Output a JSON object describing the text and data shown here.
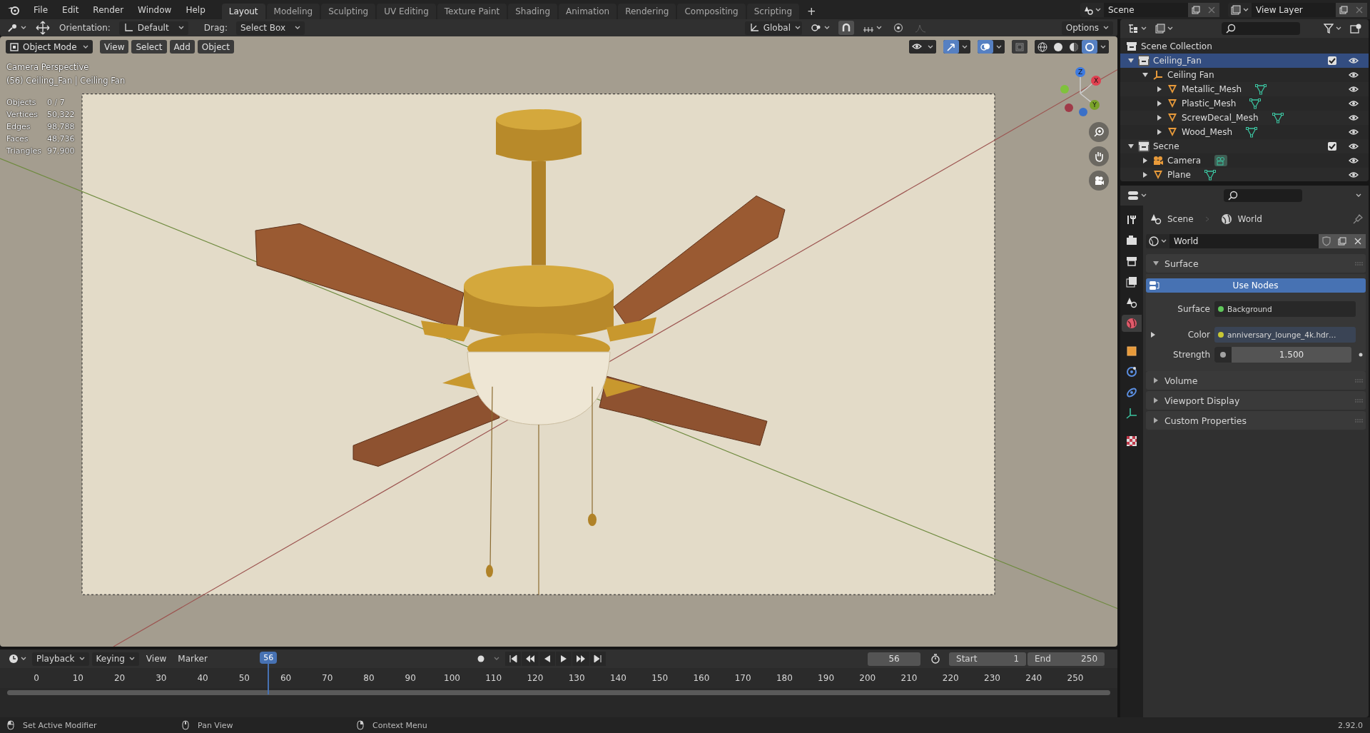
{
  "top_menu": [
    "File",
    "Edit",
    "Render",
    "Window",
    "Help"
  ],
  "workspaces": [
    {
      "label": "Layout",
      "selected": true
    },
    {
      "label": "Modeling",
      "selected": false
    },
    {
      "label": "Sculpting",
      "selected": false
    },
    {
      "label": "UV Editing",
      "selected": false
    },
    {
      "label": "Texture Paint",
      "selected": false
    },
    {
      "label": "Shading",
      "selected": false
    },
    {
      "label": "Animation",
      "selected": false
    },
    {
      "label": "Rendering",
      "selected": false
    },
    {
      "label": "Compositing",
      "selected": false
    },
    {
      "label": "Scripting",
      "selected": false
    }
  ],
  "add_workspace": "+",
  "scene_field": "Scene",
  "view_layer_field": "View Layer",
  "tool_header": {
    "orientation_label": "Orientation:",
    "orientation": "Default",
    "drag_label": "Drag:",
    "drag": "Select Box",
    "transform": "Global",
    "options": "Options"
  },
  "viewport_header": {
    "mode": "Object Mode",
    "menus": [
      "View",
      "Select",
      "Add",
      "Object"
    ],
    "toggles": [
      {
        "kind": "visibility",
        "on": false
      },
      {
        "kind": "gizmo",
        "on": true
      },
      {
        "kind": "overlay",
        "on": true
      },
      {
        "kind": "xray",
        "on": false
      }
    ],
    "shading": [
      {
        "kind": "wireframe",
        "selected": false
      },
      {
        "kind": "solid",
        "selected": false
      },
      {
        "kind": "material",
        "selected": false
      },
      {
        "kind": "rendered",
        "selected": true
      }
    ]
  },
  "viewport": {
    "view_name": "Camera Perspective",
    "object_info": "(56) Ceiling_Fan | Ceiling Fan",
    "stats": [
      {
        "label": "Objects",
        "value": "0 / 7"
      },
      {
        "label": "Vertices",
        "value": "50,322"
      },
      {
        "label": "Edges",
        "value": "98,788"
      },
      {
        "label": "Faces",
        "value": "48,736"
      },
      {
        "label": "Triangles",
        "value": "97,900"
      }
    ],
    "gizmo": {
      "x": "X",
      "y": "Y",
      "z": "Z"
    }
  },
  "outliner": {
    "root": "Scene Collection",
    "children": [
      {
        "name": "Ceiling_Fan",
        "kind": "collection",
        "expanded": true,
        "selected": true,
        "checked": true,
        "children": [
          {
            "name": "Ceiling Fan",
            "kind": "empty",
            "expanded": true,
            "selected": false,
            "children": [
              {
                "name": "Metallic_Mesh",
                "kind": "mesh",
                "expanded": false,
                "selected": false
              },
              {
                "name": "Plastic_Mesh",
                "kind": "mesh",
                "expanded": false,
                "selected": false
              },
              {
                "name": "ScrewDecal_Mesh",
                "kind": "mesh",
                "expanded": false,
                "selected": false
              },
              {
                "name": "Wood_Mesh",
                "kind": "mesh",
                "expanded": false,
                "selected": false
              }
            ]
          }
        ]
      },
      {
        "name": "Secne",
        "kind": "collection",
        "expanded": true,
        "selected": false,
        "checked": true,
        "children": [
          {
            "name": "Camera",
            "kind": "camera",
            "expanded": false,
            "selected": false
          },
          {
            "name": "Plane",
            "kind": "mesh",
            "expanded": false,
            "selected": false
          }
        ]
      }
    ]
  },
  "properties": {
    "tabs": [
      {
        "kind": "tool",
        "selected": false
      },
      {
        "kind": "render",
        "selected": false
      },
      {
        "kind": "output",
        "selected": false
      },
      {
        "kind": "view_layer",
        "selected": false
      },
      {
        "kind": "scene",
        "selected": false
      },
      {
        "kind": "world",
        "selected": true
      },
      {
        "kind": "object",
        "selected": false
      },
      {
        "kind": "physics",
        "selected": false
      },
      {
        "kind": "constraints",
        "selected": false
      },
      {
        "kind": "data",
        "selected": false
      },
      {
        "kind": "texture",
        "selected": false
      }
    ],
    "breadcrumb": [
      {
        "label": "Scene",
        "kind": "scene"
      },
      {
        "label": "World",
        "kind": "world"
      }
    ],
    "datablock": "World",
    "panels": [
      {
        "title": "Surface",
        "expanded": true,
        "use_nodes": "Use Nodes",
        "fields": [
          {
            "label": "Surface",
            "value": "Background",
            "kind": "link",
            "color": "#5fc85a",
            "expandable": false
          },
          {
            "label": "Color",
            "value": "anniversary_lounge_4k.hdr…",
            "kind": "texture",
            "color": "#c7c734",
            "expandable": true
          },
          {
            "label": "Strength",
            "value": "1.500",
            "kind": "number",
            "color": "#a1a1a1",
            "expandable": false
          }
        ]
      },
      {
        "title": "Volume",
        "expanded": false
      },
      {
        "title": "Viewport Display",
        "expanded": false
      },
      {
        "title": "Custom Properties",
        "expanded": false
      }
    ]
  },
  "timeline": {
    "menus": [
      {
        "label": "Playback",
        "dropdown": true
      },
      {
        "label": "Keying",
        "dropdown": true
      },
      {
        "label": "View",
        "dropdown": false
      },
      {
        "label": "Marker",
        "dropdown": false
      }
    ],
    "current_frame": "56",
    "start_label": "Start",
    "start": "1",
    "end_label": "End",
    "end": "250",
    "ticks": [
      "0",
      "10",
      "20",
      "30",
      "40",
      "50",
      "60",
      "70",
      "80",
      "90",
      "100",
      "110",
      "120",
      "130",
      "140",
      "150",
      "160",
      "170",
      "180",
      "190",
      "200",
      "210",
      "220",
      "230",
      "240",
      "250"
    ],
    "playhead": "56"
  },
  "status_bar": {
    "hints": [
      {
        "kind": "left",
        "text": "Set Active Modifier"
      },
      {
        "kind": "middle",
        "text": "Pan View"
      },
      {
        "kind": "right",
        "text": "Context Menu"
      }
    ],
    "version": "2.92.0"
  }
}
